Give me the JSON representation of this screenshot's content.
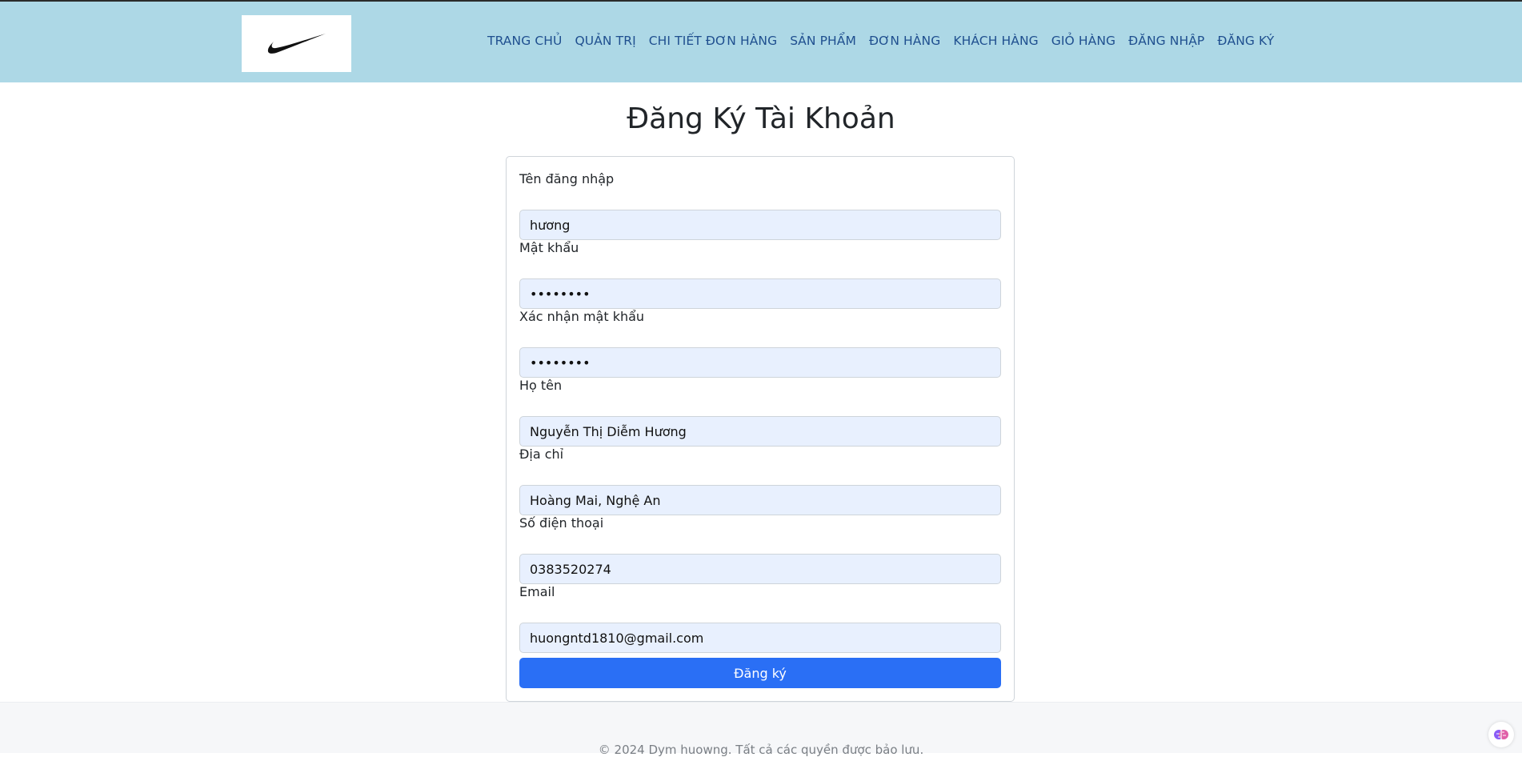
{
  "header": {
    "logo_alt": "Nike logo",
    "nav": [
      "TRANG CHỦ",
      "QUẢN TRỊ",
      "CHI TIẾT ĐƠN HÀNG",
      "SẢN PHẨM",
      "ĐƠN HÀNG",
      "KHÁCH HÀNG",
      "GIỎ HÀNG",
      "ĐĂNG NHẬP",
      "ĐĂNG KÝ"
    ]
  },
  "page": {
    "title": "Đăng Ký Tài Khoản"
  },
  "form": {
    "fields": [
      {
        "label": "Tên đăng nhập",
        "value": "hương"
      },
      {
        "label": "Mật khẩu",
        "value": "••••••••"
      },
      {
        "label": "Xác nhận mật khẩu",
        "value": "••••••••"
      },
      {
        "label": "Họ tên",
        "value": "Nguyễn Thị Diễm Hương"
      },
      {
        "label": "Địa chỉ",
        "value": "Hoàng Mai, Nghệ An"
      },
      {
        "label": "Số điện thoại",
        "value": "0383520274"
      },
      {
        "label": "Email",
        "value": "huongntd1810@gmail.com"
      }
    ],
    "submit_label": "Đăng ký"
  },
  "footer": {
    "text": "© 2024 Dym huowng. Tất cả các quyền được bảo lưu."
  },
  "colors": {
    "header_bg": "#add8e6",
    "nav_text": "#1f4f8f",
    "input_bg": "#e8f0fe",
    "button_bg": "#2a6ff5"
  }
}
